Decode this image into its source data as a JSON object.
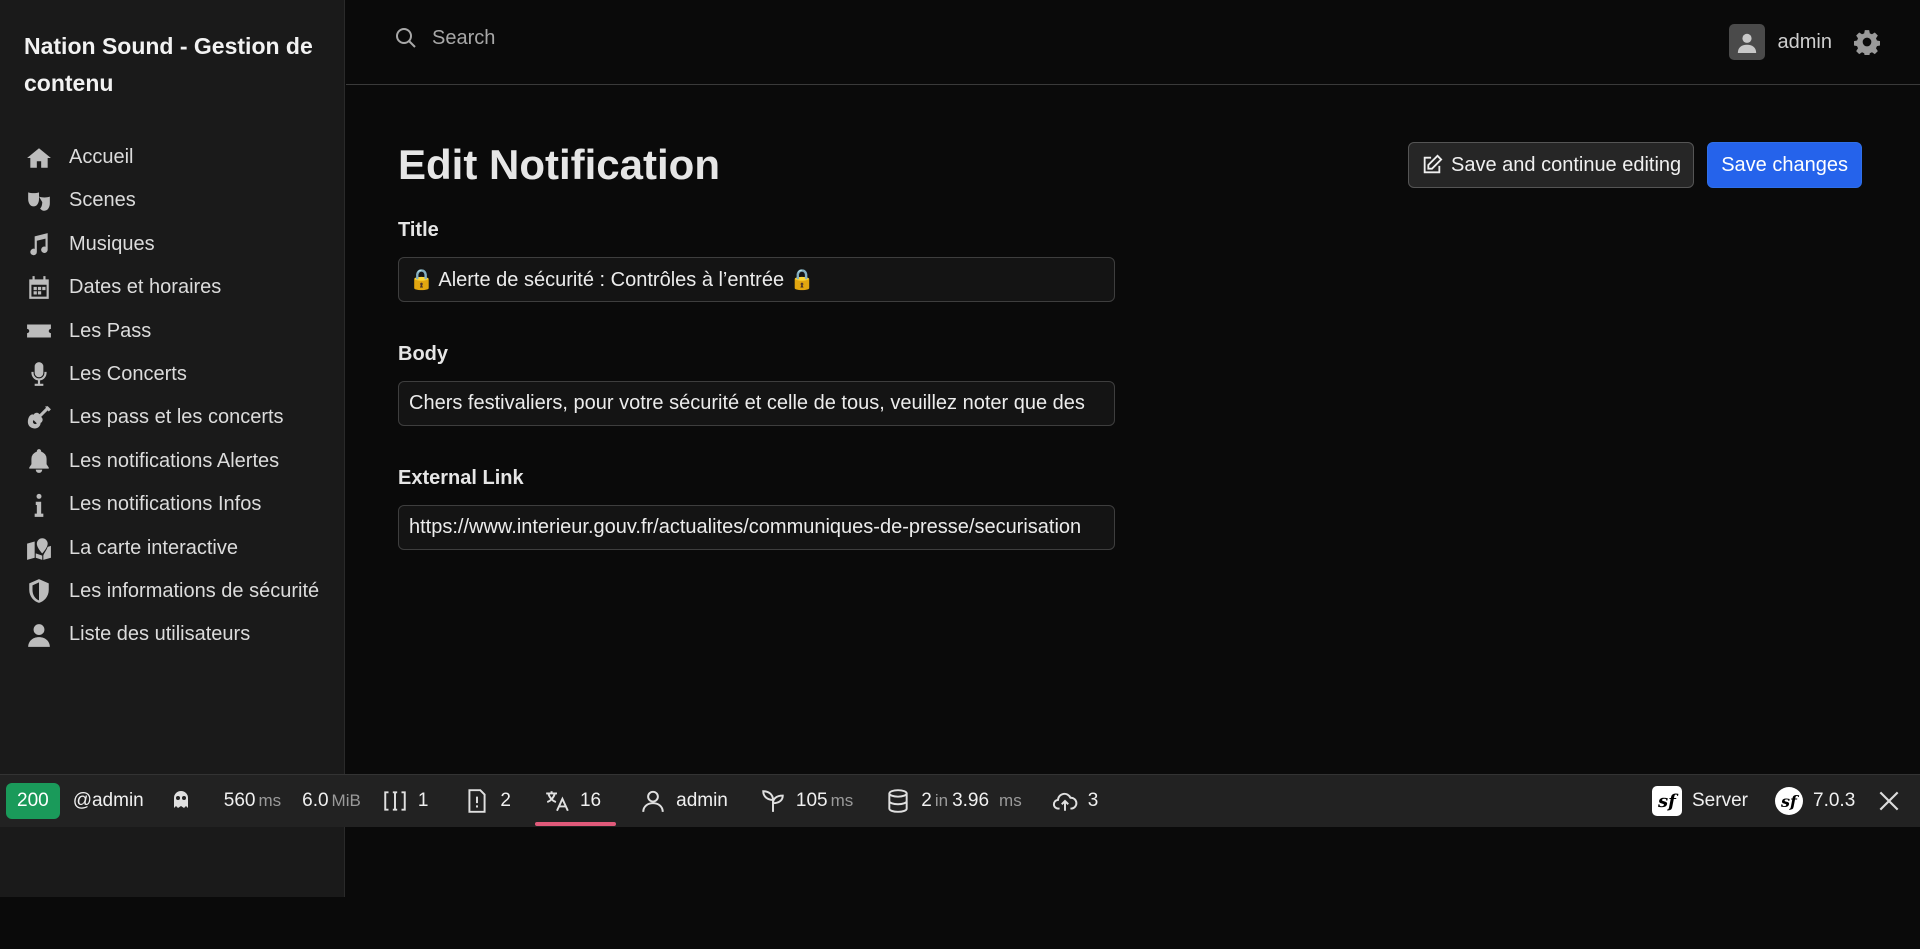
{
  "app": {
    "title": "Nation Sound - Gestion de contenu"
  },
  "sidebar": {
    "items": [
      {
        "label": "Accueil",
        "icon": "home-icon"
      },
      {
        "label": "Scenes",
        "icon": "theater-masks-icon"
      },
      {
        "label": "Musiques",
        "icon": "music-icon"
      },
      {
        "label": "Dates et horaires",
        "icon": "calendar-icon"
      },
      {
        "label": "Les Pass",
        "icon": "ticket-icon"
      },
      {
        "label": "Les Concerts",
        "icon": "microphone-icon"
      },
      {
        "label": "Les pass et les concerts",
        "icon": "guitar-icon"
      },
      {
        "label": "Les notifications Alertes",
        "icon": "bell-icon"
      },
      {
        "label": "Les notifications Infos",
        "icon": "info-icon"
      },
      {
        "label": "La carte interactive",
        "icon": "map-icon"
      },
      {
        "label": "Les informations de sécurité",
        "icon": "shield-icon"
      },
      {
        "label": "Liste des utilisateurs",
        "icon": "user-icon"
      }
    ]
  },
  "header": {
    "search_placeholder": "Search",
    "username": "admin"
  },
  "page": {
    "title": "Edit Notification",
    "save_continue_label": "Save and continue editing",
    "save_label": "Save changes"
  },
  "form": {
    "title_label": "Title",
    "title_value": "🔒 Alerte de sécurité : Contrôles à l’entrée 🔒",
    "body_label": "Body",
    "body_value": "Chers festivaliers, pour votre sécurité et celle de tous, veuillez noter que des",
    "link_label": "External Link",
    "link_value": "https://www.interieur.gouv.fr/actualites/communiques-de-presse/securisation"
  },
  "debug_toolbar": {
    "status_code": "200",
    "user": "@admin",
    "time_value": "560",
    "time_unit": "ms",
    "memory_value": "6.0",
    "memory_unit": "MiB",
    "forms_count": "1",
    "logs_count": "2",
    "translation_count": "16",
    "security_user": "admin",
    "twig_value": "105",
    "twig_unit": "ms",
    "db_queries": "2",
    "db_in": "in",
    "db_time": "3.96",
    "db_unit": "ms",
    "http_count": "3",
    "server_label": "Server",
    "symfony_version": "7.0.3",
    "status_color": "#1a9a5a",
    "accent_color": "#e05a7a"
  }
}
